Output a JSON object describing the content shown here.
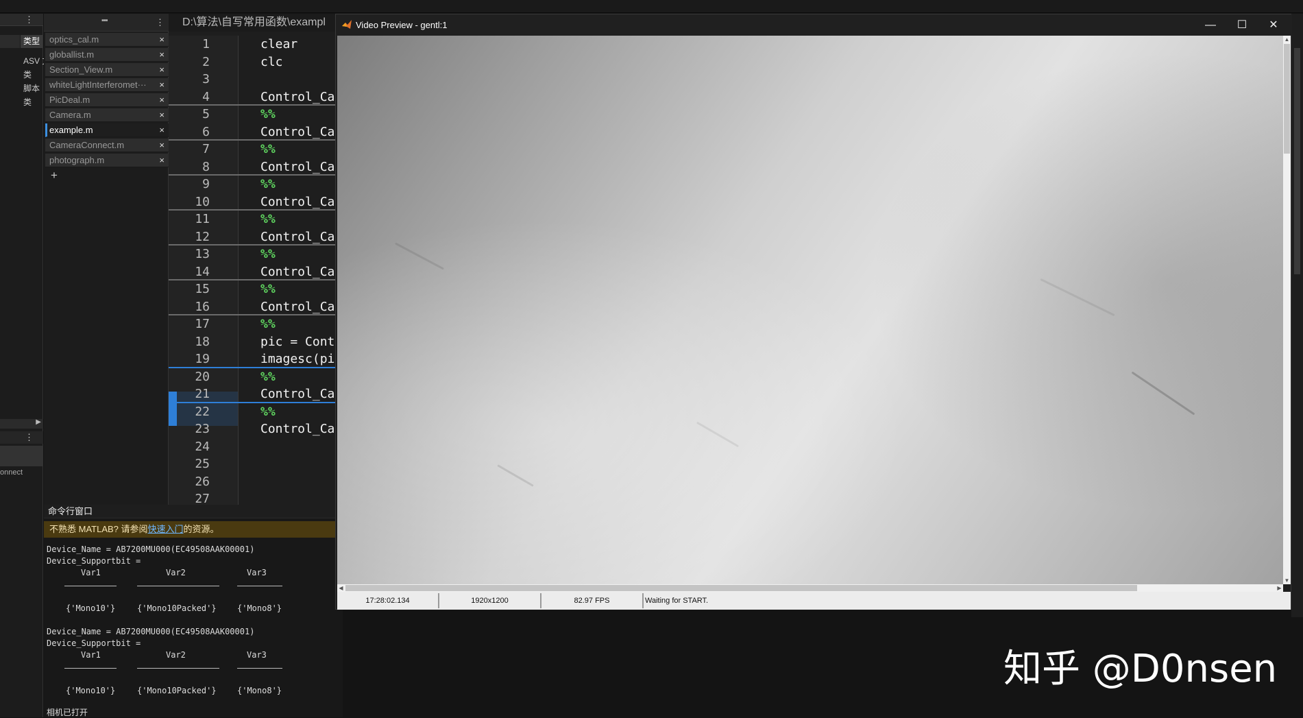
{
  "left_panel": {
    "type_header": "类型",
    "types": [
      "ASV 文",
      "类",
      "脚本",
      "类"
    ],
    "workspace_item": "onnect"
  },
  "file_tabs": [
    {
      "name": "optics_cal.m",
      "active": false
    },
    {
      "name": "globallist.m",
      "active": false
    },
    {
      "name": "Section_View.m",
      "active": false
    },
    {
      "name": "whiteLightInterferomet···",
      "active": false
    },
    {
      "name": "PicDeal.m",
      "active": false
    },
    {
      "name": "Camera.m",
      "active": false
    },
    {
      "name": "example.m",
      "active": true
    },
    {
      "name": "CameraConnect.m",
      "active": false
    },
    {
      "name": "photograph.m",
      "active": false
    }
  ],
  "file_tab_close": "×",
  "file_tab_add": "+",
  "editor": {
    "path": "D:\\算法\\自写常用函数\\exampl",
    "lines": [
      {
        "n": "1",
        "code": "clear"
      },
      {
        "n": "2",
        "code": "clc"
      },
      {
        "n": "3",
        "code": ""
      },
      {
        "n": "4",
        "code": "Control_Ca"
      },
      {
        "n": "5",
        "code": "%%"
      },
      {
        "n": "6",
        "code": "Control_Ca"
      },
      {
        "n": "7",
        "code": "%%"
      },
      {
        "n": "8",
        "code": "Control_Ca"
      },
      {
        "n": "9",
        "code": "%%"
      },
      {
        "n": "10",
        "code": "Control_Ca"
      },
      {
        "n": "11",
        "code": "%%"
      },
      {
        "n": "12",
        "code": "Control_Ca"
      },
      {
        "n": "13",
        "code": "%%"
      },
      {
        "n": "14",
        "code": "Control_Ca"
      },
      {
        "n": "15",
        "code": "%%"
      },
      {
        "n": "16",
        "code": "Control_Ca"
      },
      {
        "n": "17",
        "code": "%%"
      },
      {
        "n": "18",
        "code": "pic = Cont"
      },
      {
        "n": "19",
        "code": "imagesc(pi"
      },
      {
        "n": "20",
        "code": "%%"
      },
      {
        "n": "21",
        "code": "Control_Ca"
      },
      {
        "n": "22",
        "code": "%%"
      },
      {
        "n": "23",
        "code": "Control_Ca"
      },
      {
        "n": "24",
        "code": ""
      },
      {
        "n": "25",
        "code": ""
      },
      {
        "n": "26",
        "code": ""
      },
      {
        "n": "27",
        "code": ""
      }
    ]
  },
  "command_window": {
    "title": "命令行窗口",
    "banner_prefix": "不熟悉 MATLAB? 请参阅",
    "banner_link": "快速入门",
    "banner_suffix": "的资源。",
    "blocks": [
      {
        "device_name": "Device_Name = AB7200MU000(EC49508AAK00001)",
        "supportbit": "Device_Supportbit =",
        "headers": [
          "Var1",
          "Var2",
          "Var3"
        ],
        "values": [
          "{'Mono10'}",
          "{'Mono10Packed'}",
          "{'Mono8'}"
        ]
      },
      {
        "device_name": "Device_Name = AB7200MU000(EC49508AAK00001)",
        "supportbit": "Device_Supportbit =",
        "headers": [
          "Var1",
          "Var2",
          "Var3"
        ],
        "values": [
          "{'Mono10'}",
          "{'Mono10Packed'}",
          "{'Mono8'}"
        ]
      }
    ],
    "last_line": "相机已打开"
  },
  "video_preview": {
    "title": "Video Preview - gentl:1",
    "minimize": "—",
    "maximize": "☐",
    "close": "✕",
    "status": {
      "timestamp": "17:28:02.134",
      "resolution": "1920x1200",
      "fps": "82.97 FPS",
      "message": "Waiting for START."
    }
  },
  "watermark": "知乎 @D0nsen"
}
